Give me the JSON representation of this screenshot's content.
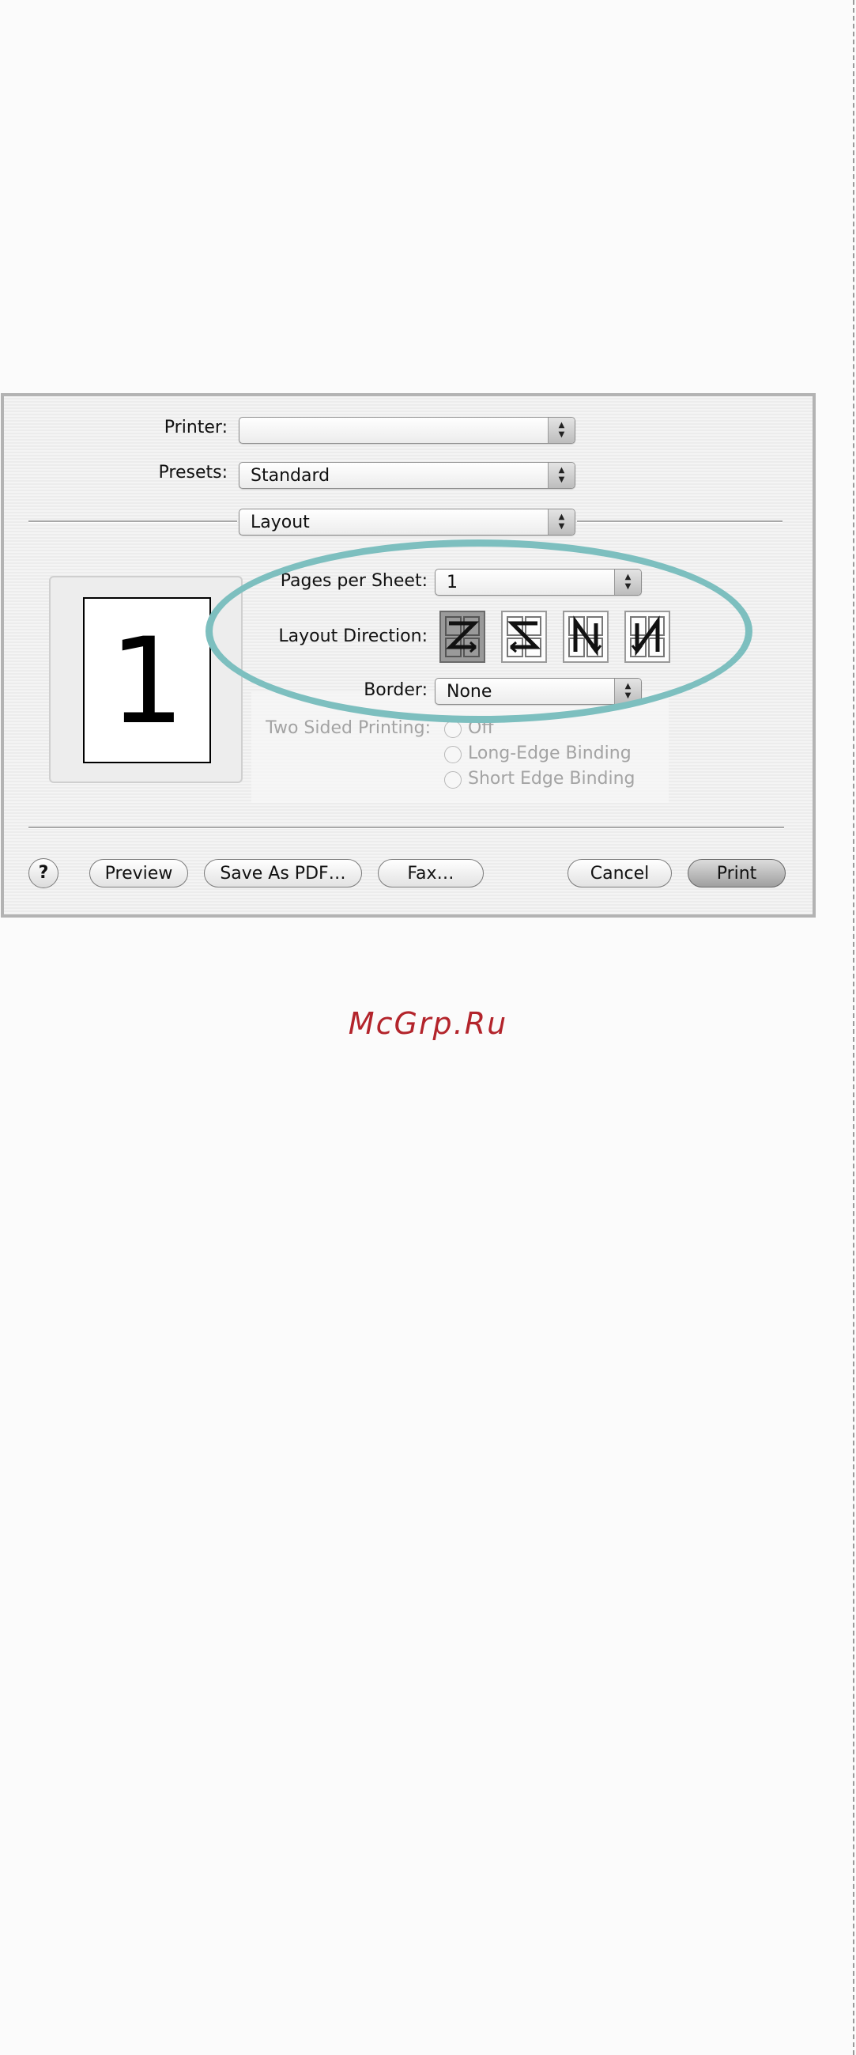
{
  "dialog": {
    "printer_label": "Printer:",
    "printer_value": "",
    "presets_label": "Presets:",
    "presets_value": "Standard",
    "panel_value": "Layout",
    "preview_page_number": "1",
    "pages_per_sheet_label": "Pages per Sheet:",
    "pages_per_sheet_value": "1",
    "layout_direction_label": "Layout Direction:",
    "layout_directions": [
      "Z",
      "S",
      "N (reversed)",
      "N"
    ],
    "layout_direction_selected": 0,
    "border_label": "Border:",
    "border_value": "None",
    "two_sided_label": "Two Sided Printing:",
    "two_sided_options": [
      "Off",
      "Long-Edge Binding",
      "Short Edge Binding"
    ]
  },
  "buttons": {
    "help": "?",
    "preview": "Preview",
    "save_pdf": "Save As PDF…",
    "fax": "Fax…",
    "cancel": "Cancel",
    "print": "Print"
  },
  "watermark": "McGrp.Ru",
  "colors": {
    "highlight": "#7dbfbf",
    "watermark": "#b3242b"
  }
}
